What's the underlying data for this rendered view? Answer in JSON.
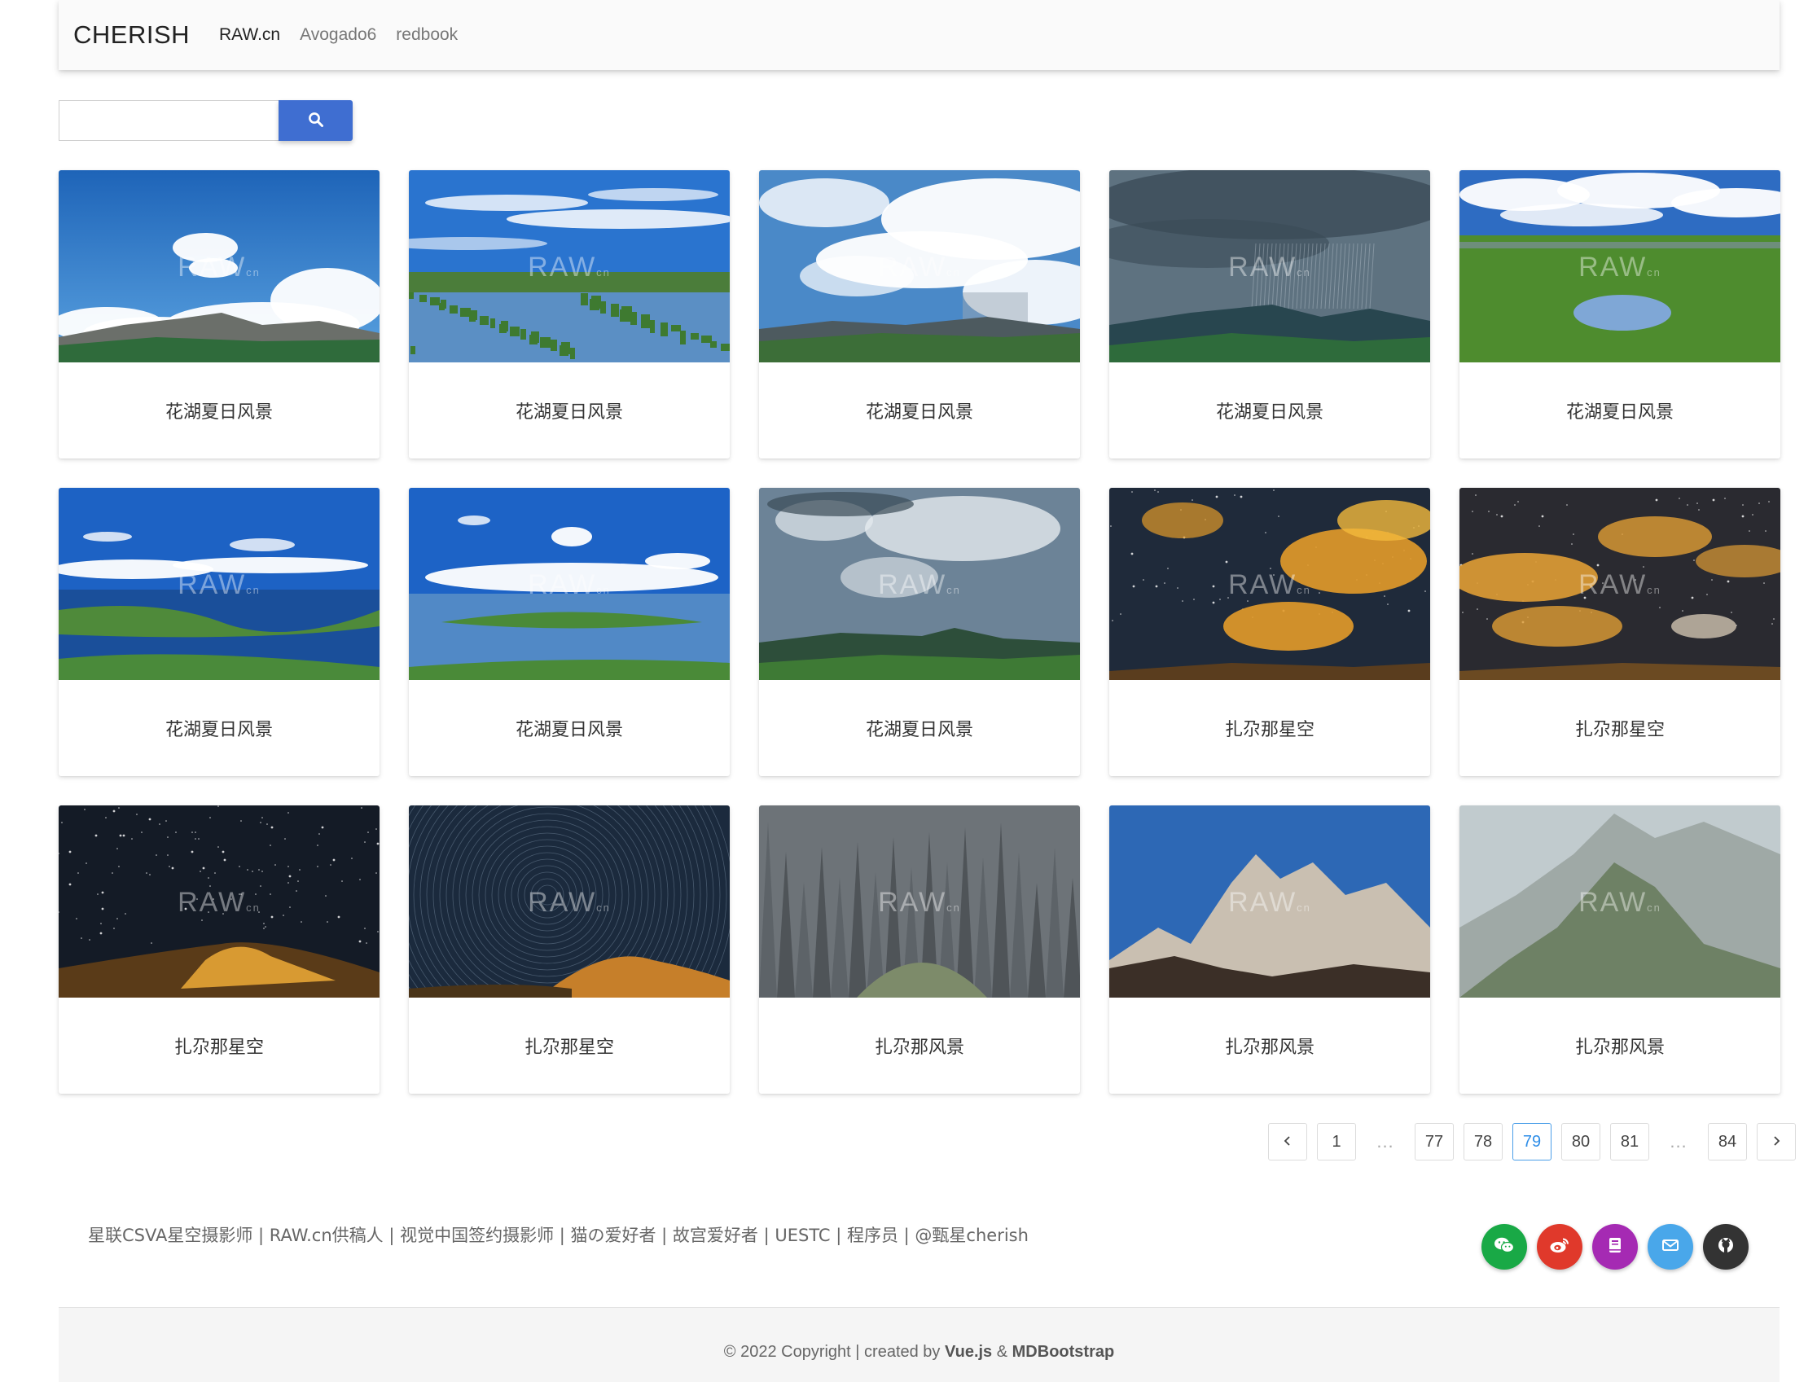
{
  "navbar": {
    "brand": "CHERISH",
    "links": [
      "RAW.cn",
      "Avogado6",
      "redbook"
    ]
  },
  "search": {
    "placeholder": "",
    "button_icon": "search-icon"
  },
  "gallery": [
    {
      "title": "花湖夏日风景",
      "scene": "peak-clouds"
    },
    {
      "title": "花湖夏日风景",
      "scene": "wetland"
    },
    {
      "title": "花湖夏日风景",
      "scene": "storm-clouds"
    },
    {
      "title": "花湖夏日风景",
      "scene": "dark-rain"
    },
    {
      "title": "花湖夏日风景",
      "scene": "meadow-pond"
    },
    {
      "title": "花湖夏日风景",
      "scene": "lake-sky"
    },
    {
      "title": "花湖夏日风景",
      "scene": "lake-clouds"
    },
    {
      "title": "花湖夏日风景",
      "scene": "green-hills"
    },
    {
      "title": "扎尕那星空",
      "scene": "golden-night"
    },
    {
      "title": "扎尕那星空",
      "scene": "golden-night-2"
    },
    {
      "title": "扎尕那星空",
      "scene": "milky-way"
    },
    {
      "title": "扎尕那星空",
      "scene": "star-trails"
    },
    {
      "title": "扎尕那风景",
      "scene": "rock-cliff"
    },
    {
      "title": "扎尕那风景",
      "scene": "sunlit-peaks"
    },
    {
      "title": "扎尕那风景",
      "scene": "misty-mountain"
    }
  ],
  "watermark": {
    "main": "RAW",
    "suffix": "cn"
  },
  "pagination": {
    "prev_icon": "chevron-left-icon",
    "next_icon": "chevron-right-icon",
    "items": [
      "1",
      "...",
      "77",
      "78",
      "79",
      "80",
      "81",
      "...",
      "84"
    ],
    "current": "79"
  },
  "footer": {
    "tagline": "星联CSVA星空摄影师 | RAW.cn供稿人 | 视觉中国签约摄影师 | 猫の爱好者 | 故宫爱好者 | UESTC | 程序员 | @甄星cherish",
    "socials": [
      {
        "icon": "wechat-icon",
        "color": "#19a946"
      },
      {
        "icon": "weibo-icon",
        "color": "#e0392b"
      },
      {
        "icon": "book-icon",
        "color": "#a52ab3"
      },
      {
        "icon": "mail-icon",
        "color": "#49a7ea"
      },
      {
        "icon": "github-icon",
        "color": "#333333"
      }
    ],
    "copyright_prefix": "© 2022 Copyright | created by ",
    "copyright_vue": "Vue.js",
    "copyright_amp": " & ",
    "copyright_mdb": "MDBootstrap"
  }
}
